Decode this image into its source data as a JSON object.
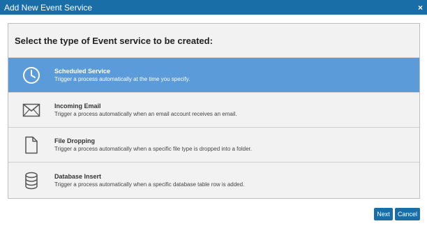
{
  "dialog": {
    "title": "Add New Event Service",
    "close_glyph": "×",
    "heading": "Select the type of Event service to be created:"
  },
  "options": [
    {
      "name": "Scheduled Service",
      "description": "Trigger a process automatically at the time you specify.",
      "icon": "clock-icon",
      "selected": true
    },
    {
      "name": "Incoming Email",
      "description": "Trigger a process automatically when an email account receives an email.",
      "icon": "envelope-icon",
      "selected": false
    },
    {
      "name": "File Dropping",
      "description": "Trigger a process automatically when a specific file type is dropped into a folder.",
      "icon": "file-icon",
      "selected": false
    },
    {
      "name": "Database Insert",
      "description": "Trigger a process automatically when a specific database table row is added.",
      "icon": "database-icon",
      "selected": false
    }
  ],
  "buttons": {
    "next": "Next",
    "cancel": "Cancel"
  },
  "colors": {
    "titlebar": "#1a6ea8",
    "selected": "#5b9bd9",
    "panel": "#f2f2f2"
  }
}
